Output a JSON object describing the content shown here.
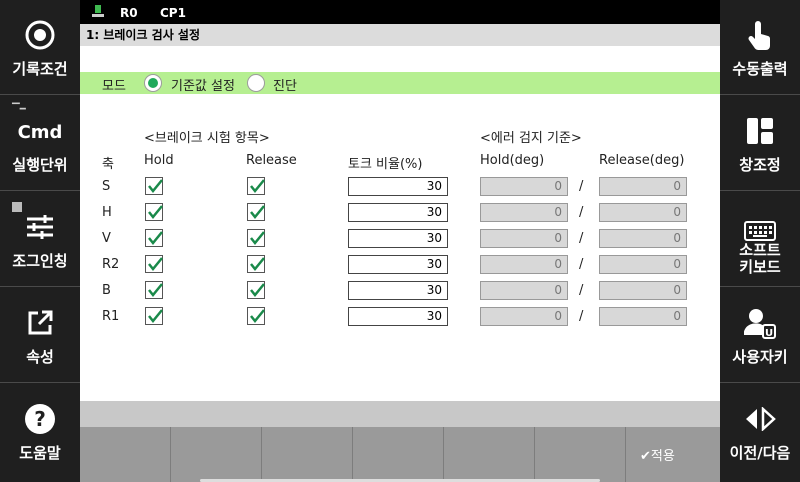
{
  "status": {
    "robot": "R0",
    "cp": "CP1"
  },
  "title": "1: 브레이크 검사 설정",
  "mode": {
    "label": "모드",
    "options": [
      {
        "label": "기준값 설정",
        "selected": true
      },
      {
        "label": "진단",
        "selected": false
      }
    ]
  },
  "sections": {
    "test_items": "<브레이크 시험 항목>",
    "error_criteria": "<에러 검지 기준>"
  },
  "columns": {
    "axis": "축",
    "hold": "Hold",
    "release": "Release",
    "torque": "토크 비율(%)",
    "hold_deg": "Hold(deg)",
    "release_deg": "Release(deg)"
  },
  "rows": [
    {
      "axis": "S",
      "hold": true,
      "release": true,
      "torque": "30",
      "hold_deg": "0",
      "release_deg": "0"
    },
    {
      "axis": "H",
      "hold": true,
      "release": true,
      "torque": "30",
      "hold_deg": "0",
      "release_deg": "0"
    },
    {
      "axis": "V",
      "hold": true,
      "release": true,
      "torque": "30",
      "hold_deg": "0",
      "release_deg": "0"
    },
    {
      "axis": "R2",
      "hold": true,
      "release": true,
      "torque": "30",
      "hold_deg": "0",
      "release_deg": "0"
    },
    {
      "axis": "B",
      "hold": true,
      "release": true,
      "torque": "30",
      "hold_deg": "0",
      "release_deg": "0"
    },
    {
      "axis": "R1",
      "hold": true,
      "release": true,
      "torque": "30",
      "hold_deg": "0",
      "release_deg": "0"
    }
  ],
  "separator": "/",
  "left_menu": [
    {
      "label": "기록조건",
      "icon": "record-icon"
    },
    {
      "label": "실행단위",
      "icon": "cmd-icon",
      "text": "Cmd"
    },
    {
      "label": "조그인칭",
      "icon": "sliders-icon"
    },
    {
      "label": "속성",
      "icon": "external-link-icon"
    },
    {
      "label": "도움말",
      "icon": "help-icon"
    }
  ],
  "right_menu": [
    {
      "label": "수동출력",
      "icon": "hand-pointer-icon"
    },
    {
      "label": "창조정",
      "icon": "window-layout-icon"
    },
    {
      "label1": "소프트",
      "label2": "키보드",
      "icon": "keyboard-icon"
    },
    {
      "label": "사용자키",
      "icon": "user-key-icon"
    },
    {
      "label": "이전/다음",
      "icon": "prev-next-icon"
    }
  ],
  "footer": {
    "apply_label": "적용"
  },
  "colors": {
    "accent_green": "#b6ef91",
    "radio_green": "#1fa95a",
    "check_green": "#1a8a4a",
    "sidebar": "#1f1f1f"
  }
}
